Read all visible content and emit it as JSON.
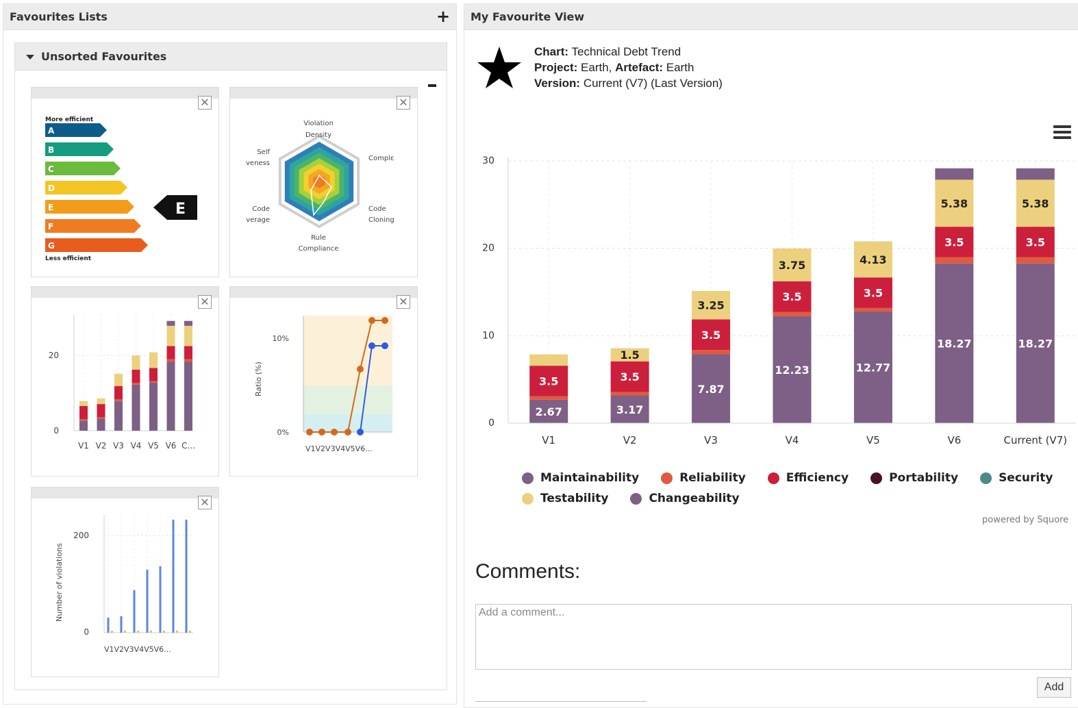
{
  "left_panel": {
    "title": "Favourites Lists",
    "add_label": "+",
    "group_title": "Unsorted Favourites",
    "close_label": "✕",
    "widgets": {
      "energy": {
        "top_label": "More efficient",
        "bottom_label": "Less efficient",
        "grades": [
          "A",
          "B",
          "C",
          "D",
          "E",
          "F",
          "G"
        ],
        "grade_colors": [
          "#0e5c8a",
          "#159c81",
          "#6cba3e",
          "#f5c523",
          "#f39c1c",
          "#ef7b22",
          "#e85c1e"
        ],
        "current": "E"
      },
      "radar": {
        "labels": [
          "Violation",
          "Density",
          "Complε",
          "Code",
          "Cloning",
          "Rule",
          "Compliance",
          "Code",
          "verage",
          "Self",
          "veness"
        ]
      },
      "mini_bar": {
        "tick_labels": [
          "0",
          "20"
        ],
        "x_labels": [
          "V1",
          "V2",
          "V3",
          "V4",
          "V5",
          "V6",
          "C..."
        ]
      },
      "ratio": {
        "ylabel": "Ratio (%)",
        "tick_labels": [
          "0%",
          "10%"
        ],
        "x_label": "V1V2V3V4V5V6..."
      },
      "violations": {
        "ylabel": "Number of violations",
        "tick_labels": [
          "0",
          "200"
        ],
        "x_label": "V1V2V3V4V5V6..."
      }
    }
  },
  "right_panel": {
    "title": "My Favourite View",
    "chart_label": "Chart:",
    "chart_value": "Technical Debt Trend",
    "project_label": "Project:",
    "project_value": "Earth",
    "artefact_label": "Artefact:",
    "artefact_value": "Earth",
    "version_label": "Version:",
    "version_value": "Current (V7) (Last Version)",
    "powered_by": "powered by Squore",
    "comments_title": "Comments:",
    "comment_placeholder": "Add a comment...",
    "add_button": "Add"
  },
  "chart_data": {
    "type": "bar",
    "stacked": true,
    "categories": [
      "V1",
      "V2",
      "V3",
      "V4",
      "V5",
      "V6",
      "Current (V7)"
    ],
    "ylim": [
      0,
      30
    ],
    "yticks": [
      0,
      10,
      20,
      30
    ],
    "grid": true,
    "legend_position": "bottom",
    "series": [
      {
        "name": "Maintainability",
        "color": "#7e5f85",
        "values": [
          2.67,
          3.17,
          7.87,
          12.23,
          12.77,
          18.27,
          18.27
        ]
      },
      {
        "name": "Reliability",
        "color": "#e05a3f",
        "values": [
          0.4,
          0.4,
          0.5,
          0.5,
          0.4,
          0.7,
          0.7
        ]
      },
      {
        "name": "Efficiency",
        "color": "#cc1f3c",
        "values": [
          3.5,
          3.5,
          3.5,
          3.5,
          3.5,
          3.5,
          3.5
        ]
      },
      {
        "name": "Portability",
        "color": "#4a1028",
        "values": [
          0,
          0,
          0,
          0,
          0,
          0,
          0
        ]
      },
      {
        "name": "Security",
        "color": "#4c8a88",
        "values": [
          0,
          0,
          0,
          0,
          0,
          0,
          0
        ]
      },
      {
        "name": "Testability",
        "color": "#ecd07e",
        "values": [
          1.3,
          1.5,
          3.25,
          3.75,
          4.13,
          5.38,
          5.38
        ]
      },
      {
        "name": "Changeability",
        "color": "#7e5f85",
        "values": [
          0,
          0,
          0,
          0,
          0,
          1.3,
          1.3
        ]
      }
    ],
    "data_labels": [
      [
        "2.67",
        "",
        "3.5",
        "",
        "",
        "",
        ""
      ],
      [
        "3.17",
        "",
        "3.5",
        "",
        "",
        "1.5",
        ""
      ],
      [
        "7.87",
        "",
        "3.5",
        "",
        "",
        "3.25",
        ""
      ],
      [
        "12.23",
        "",
        "3.5",
        "",
        "",
        "3.75",
        ""
      ],
      [
        "12.77",
        "",
        "3.5",
        "",
        "",
        "4.13",
        ""
      ],
      [
        "18.27",
        "",
        "3.5",
        "",
        "",
        "5.38",
        ""
      ],
      [
        "18.27",
        "",
        "3.5",
        "",
        "",
        "5.38",
        ""
      ]
    ]
  }
}
